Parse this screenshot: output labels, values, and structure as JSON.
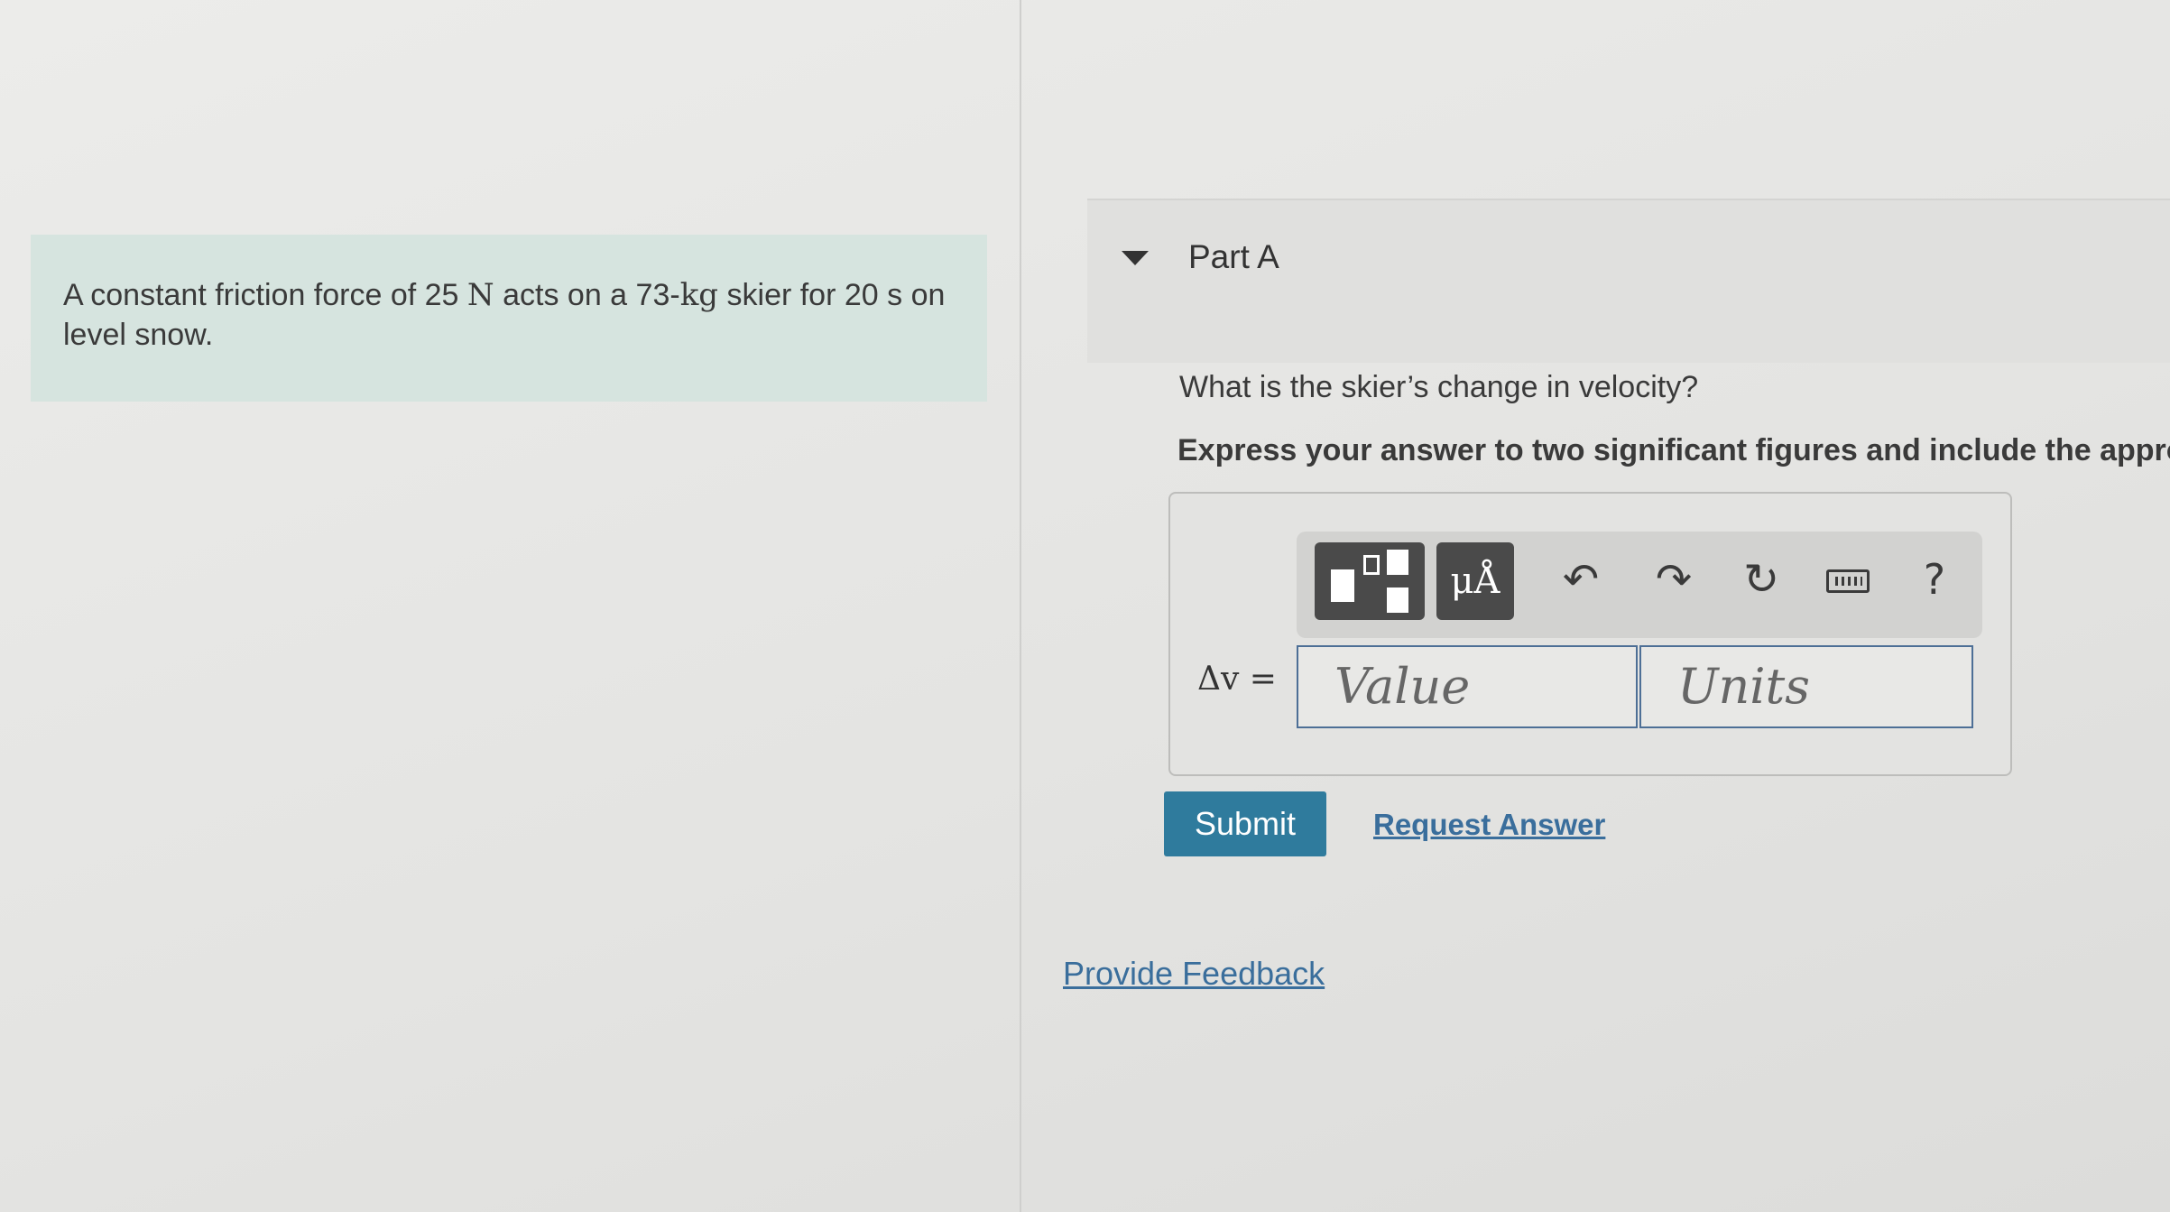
{
  "problem": {
    "text_before": "A constant friction force of 25 ",
    "force_unit": "N",
    "text_middle": " acts on a 73-",
    "mass_unit": "kg",
    "text_after": " skier for 20 s on level snow."
  },
  "part": {
    "title": "Part A",
    "question": "What is the skier’s change in velocity?",
    "instruction": "Express your answer to two significant figures and include the appro"
  },
  "toolbar": {
    "units_label": "μÅ",
    "undo_glyph": "↶",
    "redo_glyph": "↷",
    "reset_glyph": "↻",
    "help_label": "?"
  },
  "answer": {
    "variable_label": "Δv =",
    "value_placeholder": "Value",
    "units_placeholder": "Units"
  },
  "actions": {
    "submit_label": "Submit",
    "request_answer_label": "Request Answer",
    "feedback_label": "Provide Feedback"
  },
  "colors": {
    "problem_bg": "#d6e4df",
    "submit_bg": "#2f7b9d",
    "link": "#3a6e9c",
    "input_border": "#4d6f96"
  }
}
